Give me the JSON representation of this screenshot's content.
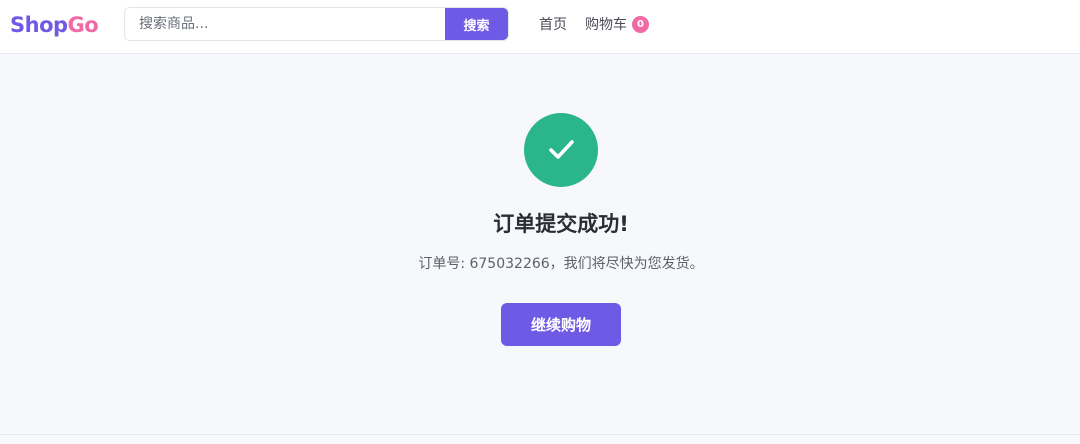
{
  "header": {
    "brand": {
      "part1": "Shop",
      "part2": "Go",
      "colors": {
        "part1": "#6f5ae6",
        "part2": "#f06aa6"
      }
    },
    "search": {
      "placeholder": "搜索商品...",
      "button_label": "搜索"
    },
    "nav": {
      "home": "首页",
      "cart": "购物车",
      "cart_count": "0"
    }
  },
  "main": {
    "success_icon": "check-icon",
    "title": "订单提交成功!",
    "message": "订单号: 675032266，我们将尽快为您发货。",
    "continue_button": "继续购物"
  },
  "colors": {
    "accent": "#6f5ae6",
    "success": "#2ab58a",
    "badge": "#f06aa6",
    "page_background": "#f7f8fc"
  }
}
